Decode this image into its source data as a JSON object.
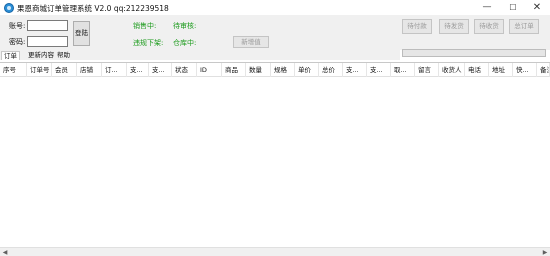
{
  "window": {
    "title": "果恩商城订单管理系统 V2.0   qq:212239518",
    "icon": "app-globe-icon",
    "min": "—",
    "max": "☐",
    "close": "✕"
  },
  "login": {
    "account_label": "账号:",
    "account_value": "",
    "password_label": "密码:",
    "password_value": "",
    "login_button": "登陆"
  },
  "status": {
    "on_sale": "销售中:",
    "pending_review": "待审核:",
    "violation_removed": "违规下架:",
    "in_warehouse": "仓库中:",
    "color": "#1a9a1a"
  },
  "toolbar": {
    "new_value_button": "新增值",
    "pending_payment": "待付款",
    "pending_shipment": "待发货",
    "pending_receipt": "待收货",
    "total_orders": "总订单"
  },
  "progress": {
    "value": 0,
    "color": "#06b025"
  },
  "tabs": [
    {
      "label": "订单"
    },
    {
      "label": "更新内容"
    },
    {
      "label": "帮助"
    }
  ],
  "columns": [
    "序号",
    "订单号",
    "会员",
    "店铺",
    "订...",
    "支...",
    "支...",
    "状态",
    "ID",
    "商品",
    "数量",
    "规格",
    "单价",
    "总价",
    "支...",
    "支...",
    "取...",
    "留言",
    "收货人",
    "电话",
    "地址",
    "快...",
    "备注"
  ]
}
